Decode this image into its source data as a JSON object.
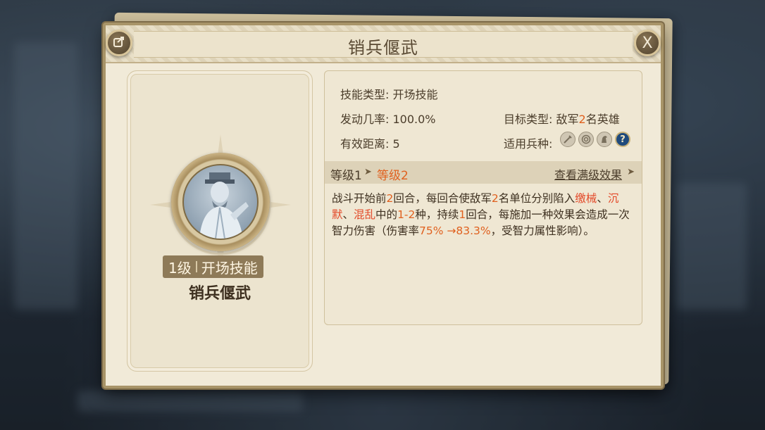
{
  "dialog": {
    "title": "销兵偃武",
    "close_glyph": "X"
  },
  "left_card": {
    "level_badge": "1级",
    "skill_type_badge": "开场技能",
    "skill_name": "销兵偃武"
  },
  "info": {
    "skill_type_label": "技能类型:",
    "skill_type_value": "开场技能",
    "trigger_rate_label": "发动几率:",
    "trigger_rate_value": "100.0%",
    "range_label": "有效距离:",
    "range_value": "5",
    "target_label": "目标类型:",
    "target_value_pre": "敌军",
    "target_value_num": "2",
    "target_value_post": "名英雄",
    "troop_label": "适用兵种:",
    "troop_icons": [
      "sword-icon",
      "bow-target-icon",
      "horse-icon",
      "question-icon"
    ]
  },
  "level_bar": {
    "level_1": "等级1",
    "level_2": "等级2",
    "max_level_link": "查看满级效果"
  },
  "description": {
    "p1": "战斗开始前",
    "n1": "2",
    "p2": "回合，每回合使敌军",
    "n2": "2",
    "p3": "名单位分别陷入",
    "s1": "缴械",
    "p4": "、",
    "s2": "沉默",
    "p5": "、",
    "s3": "混乱",
    "p6": "中的",
    "n3": "1-2",
    "p7": "种，持续",
    "n4": "1",
    "p8": "回合，每施加一种效果会造成一次智力伤害（伤害率",
    "n5": "75% →83.3%",
    "p9": "，受智力属性影响）。"
  },
  "colors": {
    "highlight_orange": "#e0611f",
    "status_red": "#e34a2a",
    "panel_bg": "#f1ead8",
    "frame": "#a89468"
  }
}
